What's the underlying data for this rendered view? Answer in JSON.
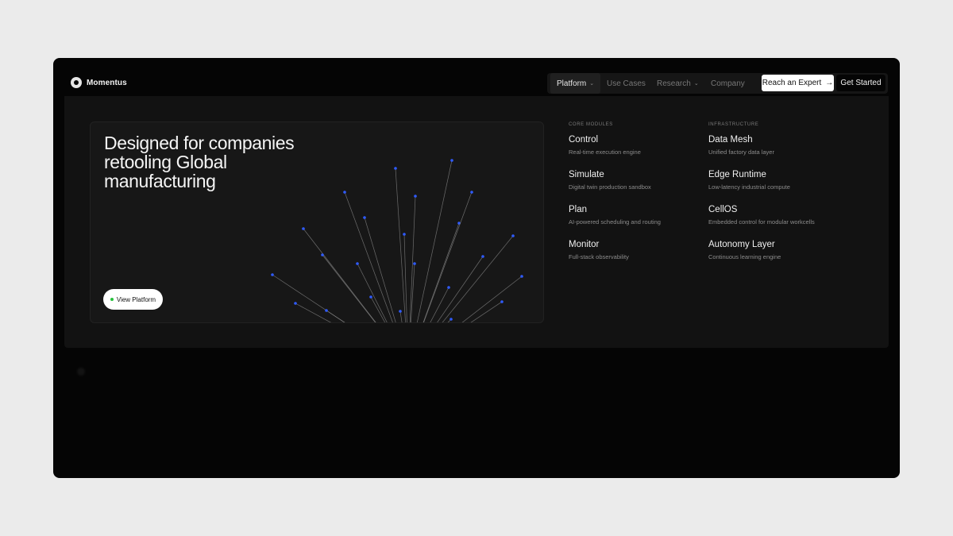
{
  "brand": {
    "name": "Momentus",
    "logo_icon": "momentus-logo-icon"
  },
  "nav": {
    "items": [
      {
        "label": "Platform",
        "has_menu": true,
        "active": true
      },
      {
        "label": "Use Cases",
        "has_menu": false,
        "active": false
      },
      {
        "label": "Research",
        "has_menu": true,
        "active": false
      },
      {
        "label": "Company",
        "has_menu": false,
        "active": false
      }
    ],
    "chevron": "⌄",
    "expert_label": "Reach an Expert",
    "expert_arrow": "→",
    "start_label": "Get Started"
  },
  "feature": {
    "title": "Designed for companies retooling Global manufacturing",
    "button_label": "View Platform",
    "accent_color": "#2f5bff"
  },
  "columns": [
    {
      "heading": "CORE MODULES",
      "items": [
        {
          "name": "Control",
          "desc": "Real-time execution engine"
        },
        {
          "name": "Simulate",
          "desc": "Digital twin production sandbox"
        },
        {
          "name": "Plan",
          "desc": "AI-powered scheduling and routing"
        },
        {
          "name": "Monitor",
          "desc": "Full-stack observability"
        }
      ]
    },
    {
      "heading": "INFRASTRUCTURE",
      "items": [
        {
          "name": "Data Mesh",
          "desc": "Unified factory data layer"
        },
        {
          "name": "Edge Runtime",
          "desc": "Low-latency industrial compute"
        },
        {
          "name": "CellOS",
          "desc": "Embedded control for modular workcells"
        },
        {
          "name": "Autonomy Layer",
          "desc": "Continuous learning engine"
        }
      ]
    }
  ]
}
